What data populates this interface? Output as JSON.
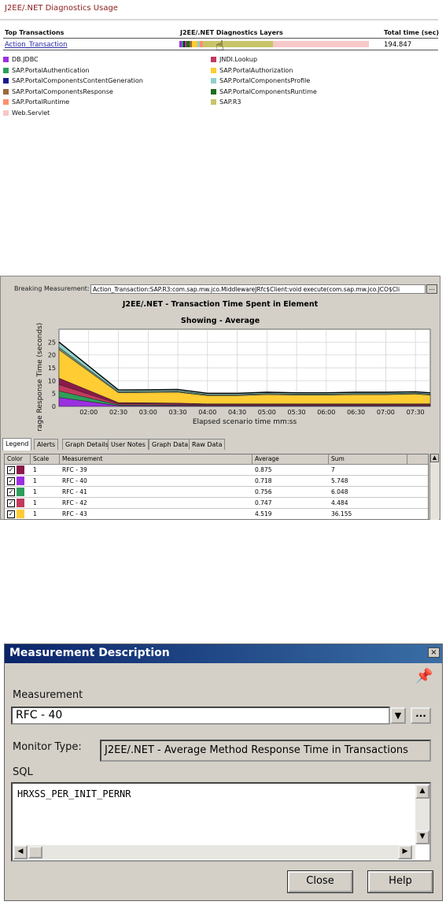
{
  "diagnostics_usage": {
    "title": "J2EE/.NET Diagnostics Usage",
    "headers": {
      "top_transactions": "Top Transactions",
      "layers": "J2EE/.NET Diagnostics Layers",
      "total_time": "Total time (sec)"
    },
    "transaction": {
      "name": "Action_Transaction",
      "total_time": "194.847"
    },
    "layer_bar_segments": [
      {
        "color": "#9b30e0",
        "fraction": 0.012
      },
      {
        "color": "#2e9e5b",
        "fraction": 0.01
      },
      {
        "color": "#1a1a6e",
        "fraction": 0.006
      },
      {
        "color": "#c23a5e",
        "fraction": 0.008
      },
      {
        "color": "#1e6e1e",
        "fraction": 0.02
      },
      {
        "color": "#9a6a3a",
        "fraction": 0.01
      },
      {
        "color": "#ffcc33",
        "fraction": 0.03
      },
      {
        "color": "#8fd0cc",
        "fraction": 0.012
      },
      {
        "color": "#ff8f6a",
        "fraction": 0.015
      },
      {
        "color": "#c8c468",
        "fraction": 0.37
      },
      {
        "color": "#f6c8c8",
        "fraction": 0.507
      }
    ],
    "legend": [
      {
        "label": "DB.JDBC",
        "color": "#9b30e0"
      },
      {
        "label": "JNDI.Lookup",
        "color": "#c23a5e"
      },
      {
        "label": "SAP.PortalAuthentication",
        "color": "#2e9e5b"
      },
      {
        "label": "SAP.PortalAuthorization",
        "color": "#ffcc33"
      },
      {
        "label": "SAP.PortalComponentsContentGeneration",
        "color": "#1a1a8e"
      },
      {
        "label": "SAP.PortalComponentsProfile",
        "color": "#8fd0cc"
      },
      {
        "label": "SAP.PortalComponentsResponse",
        "color": "#9a6a3a"
      },
      {
        "label": "SAP.PortalComponentsRuntime",
        "color": "#1e6e1e"
      },
      {
        "label": "SAP.PortalRuntime",
        "color": "#ff8f6a"
      },
      {
        "label": "SAP.R3",
        "color": "#c8c468"
      },
      {
        "label": "Web.Servlet",
        "color": "#f6c8c8"
      }
    ]
  },
  "graph_window": {
    "breaking_label": "Breaking Measurement:",
    "breaking_value": "Action_Transaction:SAP.R3:com.sap.mw.jco.MiddlewareJRfc$Client:void execute(com.sap.mw.jco.JCO$Cli",
    "browse_label": "...",
    "tabs": [
      "Legend",
      "Alerts",
      "Graph Details",
      "User Notes",
      "Graph Data",
      "Raw Data"
    ],
    "grid": {
      "headers": [
        "Color",
        "Scale",
        "Measurement",
        "Average",
        "Sum"
      ],
      "rows": [
        {
          "color": "#8b1a4a",
          "scale": "1",
          "measurement": "RFC - 39",
          "average": "0.875",
          "sum": "7"
        },
        {
          "color": "#9b30e0",
          "scale": "1",
          "measurement": "RFC - 40",
          "average": "0.718",
          "sum": "5.748"
        },
        {
          "color": "#2e9e5b",
          "scale": "1",
          "measurement": "RFC - 41",
          "average": "0.756",
          "sum": "6.048"
        },
        {
          "color": "#c23a5e",
          "scale": "1",
          "measurement": "RFC - 42",
          "average": "0.747",
          "sum": "4.484"
        },
        {
          "color": "#ffcc33",
          "scale": "1",
          "measurement": "RFC - 43",
          "average": "4.519",
          "sum": "36.155"
        }
      ]
    }
  },
  "chart_data": {
    "type": "area",
    "title": "J2EE/.NET - Transaction Time Spent in Element",
    "subtitle": "Showing - Average",
    "xlabel": "Elapsed scenario time mm:ss",
    "ylabel": "Average Response Time (seconds)",
    "ylim": [
      0,
      30
    ],
    "yticks": [
      0,
      5,
      10,
      15,
      20,
      25
    ],
    "xtick_labels": [
      "02:00",
      "02:30",
      "03:00",
      "03:30",
      "04:00",
      "04:30",
      "05:00",
      "05:30",
      "06:00",
      "06:30",
      "07:00",
      "07:30"
    ],
    "x": [
      "01:30",
      "02:30",
      "03:00",
      "03:30",
      "04:00",
      "04:30",
      "05:00",
      "05:30",
      "06:00",
      "06:30",
      "07:00",
      "07:30",
      "07:45"
    ],
    "grid": true,
    "stacked": true,
    "series": [
      {
        "color": "#9b30e0",
        "values": [
          3.5,
          0.3,
          0.3,
          0.3,
          0.2,
          0.2,
          0.2,
          0.2,
          0.2,
          0.2,
          0.2,
          0.2,
          0.2
        ]
      },
      {
        "color": "#2e9e5b",
        "values": [
          2.5,
          0.3,
          0.3,
          0.2,
          0.2,
          0.2,
          0.2,
          0.2,
          0.2,
          0.2,
          0.2,
          0.2,
          0.2
        ]
      },
      {
        "color": "#c23a5e",
        "values": [
          2.5,
          0.4,
          0.4,
          0.4,
          0.3,
          0.3,
          0.3,
          0.3,
          0.3,
          0.3,
          0.3,
          0.3,
          0.3
        ]
      },
      {
        "color": "#8b1a4a",
        "values": [
          2.5,
          0.5,
          0.4,
          0.4,
          0.3,
          0.3,
          0.3,
          0.3,
          0.3,
          0.3,
          0.3,
          0.3,
          0.3
        ]
      },
      {
        "color": "#ffcc33",
        "values": [
          11.0,
          3.8,
          4.0,
          4.2,
          3.2,
          3.2,
          3.6,
          3.4,
          3.4,
          3.6,
          3.6,
          3.8,
          3.4
        ]
      },
      {
        "color": "#6a8a6a",
        "values": [
          1.0,
          0.5,
          0.5,
          0.5,
          0.4,
          0.4,
          0.4,
          0.4,
          0.4,
          0.4,
          0.4,
          0.4,
          0.4
        ]
      },
      {
        "color": "#8fd0cc",
        "values": [
          2.0,
          0.6,
          0.6,
          0.6,
          0.5,
          0.5,
          0.5,
          0.5,
          0.5,
          0.5,
          0.5,
          0.5,
          0.5
        ]
      }
    ]
  },
  "measurement_dialog": {
    "title": "Measurement Description",
    "close_icon": "×",
    "measurement_label": "Measurement",
    "measurement_value": "RFC - 40",
    "browse_label": "...",
    "monitor_type_label": "Monitor Type:",
    "monitor_type_value": "J2EE/.NET - Average Method Response Time in Transactions",
    "sql_label": "SQL",
    "sql_value": "HRXSS_PER_INIT_PERNR",
    "close_button": "Close",
    "help_button": "Help"
  }
}
